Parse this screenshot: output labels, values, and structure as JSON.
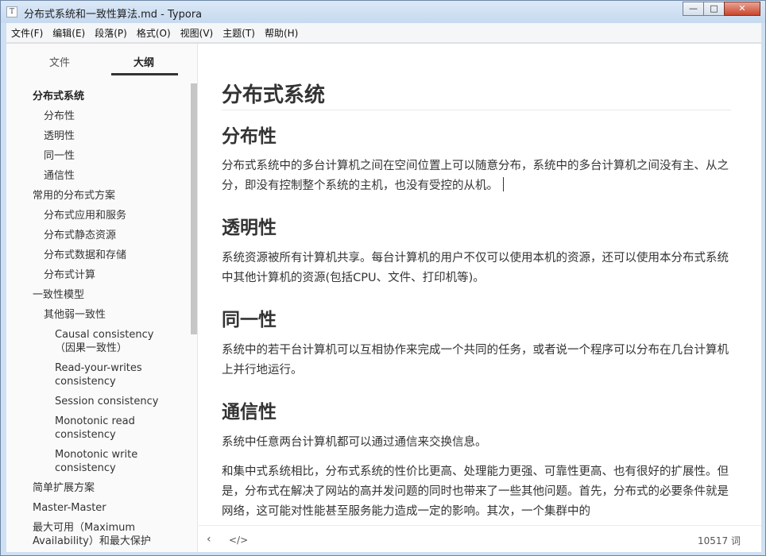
{
  "window": {
    "title": "分布式系统和一致性算法.md - Typora",
    "app_icon": "T",
    "minimize_glyph": "—",
    "maximize_glyph": "□",
    "close_glyph": "✕"
  },
  "menu": {
    "items": [
      "文件(F)",
      "编辑(E)",
      "段落(P)",
      "格式(O)",
      "视图(V)",
      "主题(T)",
      "帮助(H)"
    ]
  },
  "sidebar": {
    "tabs": {
      "files": "文件",
      "outline": "大纲"
    },
    "active_tab": "outline",
    "outline": [
      {
        "label": "分布式系统",
        "level": 1
      },
      {
        "label": "分布性",
        "level": 2
      },
      {
        "label": "透明性",
        "level": 2
      },
      {
        "label": "同一性",
        "level": 2
      },
      {
        "label": "通信性",
        "level": 2
      },
      {
        "label": "常用的分布式方案",
        "level": 1
      },
      {
        "label": "分布式应用和服务",
        "level": 2
      },
      {
        "label": "分布式静态资源",
        "level": 2
      },
      {
        "label": "分布式数据和存储",
        "level": 2
      },
      {
        "label": "分布式计算",
        "level": 2
      },
      {
        "label": "一致性模型",
        "level": 1
      },
      {
        "label": "其他弱一致性",
        "level": 2
      },
      {
        "label": "Causal consistency（因果一致性）",
        "level": 3
      },
      {
        "label": "Read-your-writes consistency",
        "level": 3
      },
      {
        "label": "Session consistency",
        "level": 3
      },
      {
        "label": "Monotonic read consistency",
        "level": 3
      },
      {
        "label": "Monotonic write consistency",
        "level": 3
      },
      {
        "label": "简单扩展方案",
        "level": 1
      },
      {
        "label": "Master-Master",
        "level": 1
      },
      {
        "label": "最大可用（Maximum Availability）和最大保护",
        "level": 1
      }
    ]
  },
  "document": {
    "h1": "分布式系统",
    "sections": [
      {
        "heading": "分布性",
        "paragraph": "分布式系统中的多台计算机之间在空间位置上可以随意分布，系统中的多台计算机之间没有主、从之分，即没有控制整个系统的主机，也没有受控的从机。"
      },
      {
        "heading": "透明性",
        "paragraph": "系统资源被所有计算机共享。每台计算机的用户不仅可以使用本机的资源，还可以使用本分布式系统中其他计算机的资源(包括CPU、文件、打印机等)。"
      },
      {
        "heading": "同一性",
        "paragraph": "系统中的若干台计算机可以互相协作来完成一个共同的任务，或者说一个程序可以分布在几台计算机上并行地运行。"
      },
      {
        "heading": "通信性",
        "paragraph": "系统中任意两台计算机都可以通过通信来交换信息。"
      }
    ],
    "trailing_paragraph": "和集中式系统相比，分布式系统的性价比更高、处理能力更强、可靠性更高、也有很好的扩展性。但是，分布式在解决了网站的高并发问题的同时也带来了一些其他问题。首先，分布式的必要条件就是网络，这可能对性能甚至服务能力造成一定的影响。其次，一个集群中的"
  },
  "footer": {
    "back_icon": "chevron-left-icon",
    "source_icon": "code-icon",
    "back_glyph": "‹",
    "source_glyph": "</>",
    "word_count": "10517 词"
  }
}
